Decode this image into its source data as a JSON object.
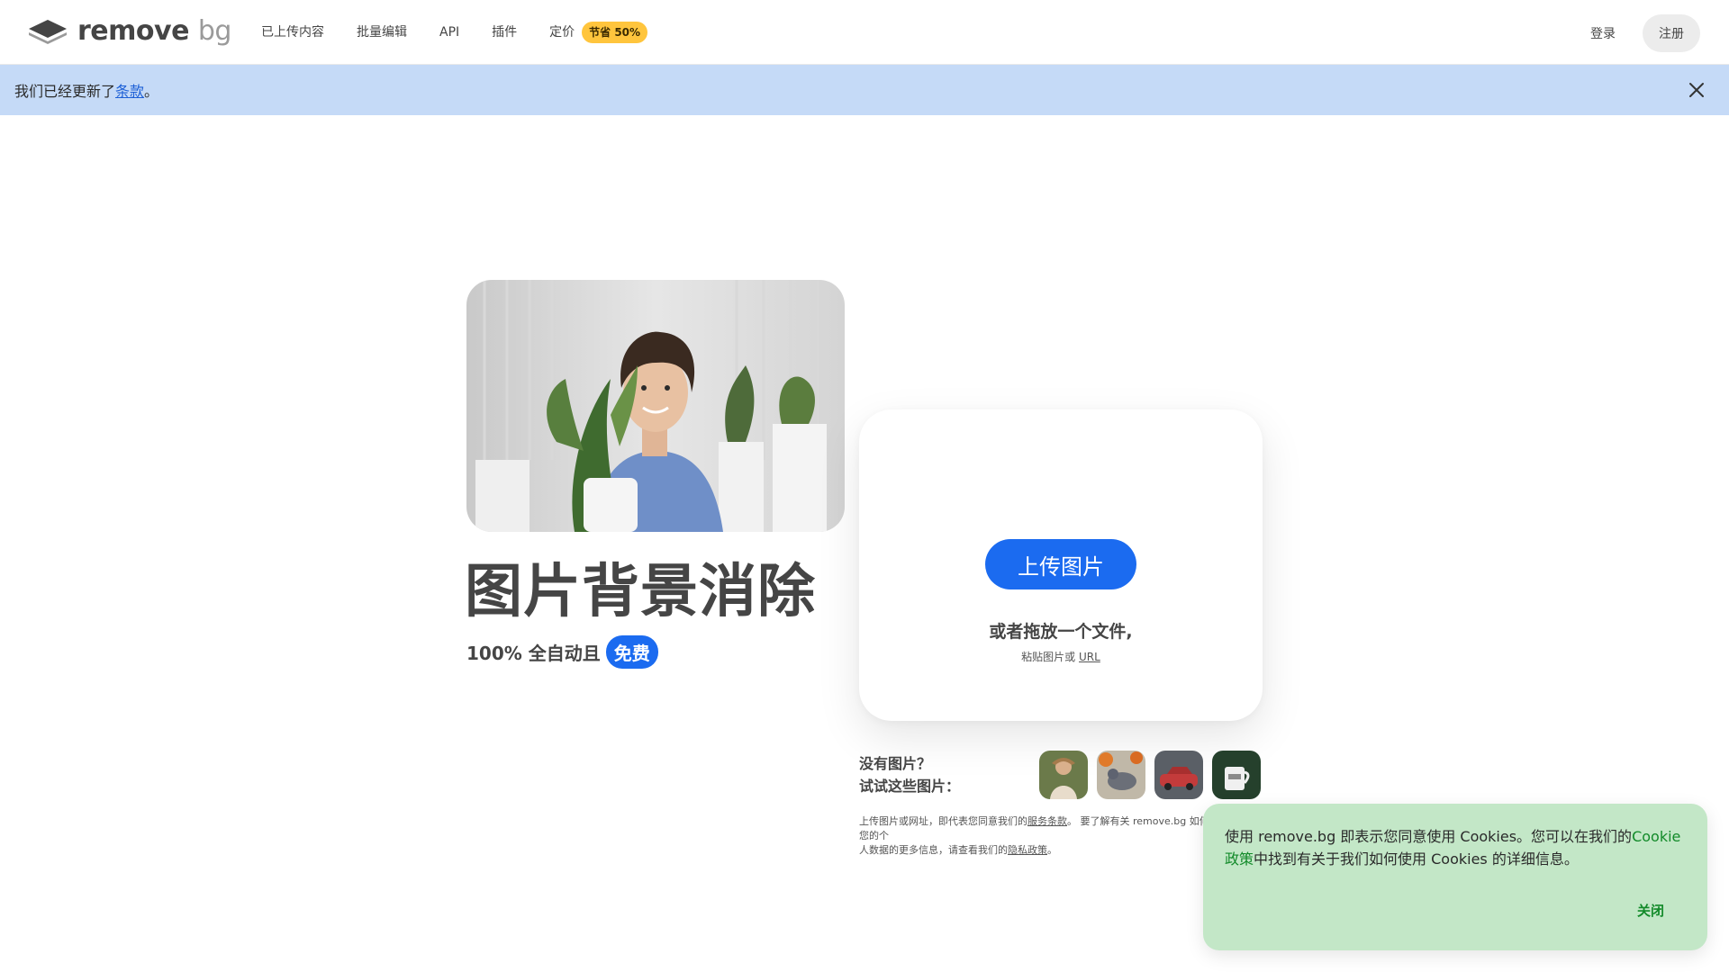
{
  "header": {
    "logo_word": "remove",
    "logo_bg": "bg",
    "nav": [
      "已上传内容",
      "批量编辑",
      "API",
      "插件",
      "定价"
    ],
    "save_badge": "节省 50%",
    "login": "登录",
    "signup": "注册"
  },
  "banner": {
    "text_before": "我们已经更新了",
    "link": "条款",
    "text_after": "。",
    "close_icon": "close-icon"
  },
  "hero": {
    "title": "图片背景消除",
    "subtitle": "100% 全自动且",
    "free": "免费"
  },
  "upload": {
    "button": "上传图片",
    "drop": "或者拖放一个文件,",
    "paste_before": "粘贴图片或",
    "paste_url": "URL"
  },
  "samples": {
    "line1": "没有图片？",
    "line2": "试试这些图片：",
    "items": [
      "sample-woman",
      "sample-pigeon",
      "sample-car",
      "sample-mug"
    ]
  },
  "legal": {
    "part1": "上传图片或网址，即代表您同意我们的",
    "tos": "服务条款",
    "part2": "。 要了解有关 remove.bg 如何处理您的个",
    "part3": "人数据的更多信息，请查看我们的",
    "privacy": "隐私政策",
    "part4": "。"
  },
  "cookie": {
    "text_before": "使用 remove.bg 即表示您同意使用 Cookies。您可以在我们的",
    "link": "Cookie政策",
    "text_after": "中找到有关于我们如何使用 Cookies 的详细信息。",
    "close": "关闭"
  },
  "colors": {
    "accent": "#1b6bf0",
    "banner_bg": "#c5daf7",
    "cookie_bg": "#c3e7c7",
    "badge": "#ffc53d"
  }
}
